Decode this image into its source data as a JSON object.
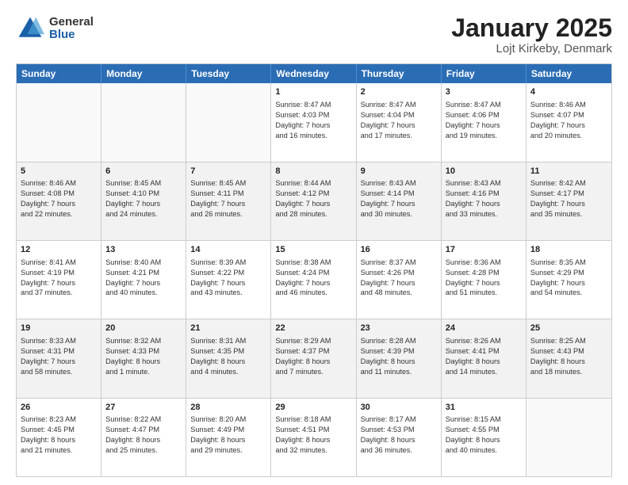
{
  "logo": {
    "general": "General",
    "blue": "Blue"
  },
  "title": "January 2025",
  "subtitle": "Lojt Kirkeby, Denmark",
  "days": [
    "Sunday",
    "Monday",
    "Tuesday",
    "Wednesday",
    "Thursday",
    "Friday",
    "Saturday"
  ],
  "weeks": [
    [
      {
        "day": "",
        "content": ""
      },
      {
        "day": "",
        "content": ""
      },
      {
        "day": "",
        "content": ""
      },
      {
        "day": "1",
        "content": "Sunrise: 8:47 AM\nSunset: 4:03 PM\nDaylight: 7 hours\nand 16 minutes."
      },
      {
        "day": "2",
        "content": "Sunrise: 8:47 AM\nSunset: 4:04 PM\nDaylight: 7 hours\nand 17 minutes."
      },
      {
        "day": "3",
        "content": "Sunrise: 8:47 AM\nSunset: 4:06 PM\nDaylight: 7 hours\nand 19 minutes."
      },
      {
        "day": "4",
        "content": "Sunrise: 8:46 AM\nSunset: 4:07 PM\nDaylight: 7 hours\nand 20 minutes."
      }
    ],
    [
      {
        "day": "5",
        "content": "Sunrise: 8:46 AM\nSunset: 4:08 PM\nDaylight: 7 hours\nand 22 minutes."
      },
      {
        "day": "6",
        "content": "Sunrise: 8:45 AM\nSunset: 4:10 PM\nDaylight: 7 hours\nand 24 minutes."
      },
      {
        "day": "7",
        "content": "Sunrise: 8:45 AM\nSunset: 4:11 PM\nDaylight: 7 hours\nand 26 minutes."
      },
      {
        "day": "8",
        "content": "Sunrise: 8:44 AM\nSunset: 4:12 PM\nDaylight: 7 hours\nand 28 minutes."
      },
      {
        "day": "9",
        "content": "Sunrise: 8:43 AM\nSunset: 4:14 PM\nDaylight: 7 hours\nand 30 minutes."
      },
      {
        "day": "10",
        "content": "Sunrise: 8:43 AM\nSunset: 4:16 PM\nDaylight: 7 hours\nand 33 minutes."
      },
      {
        "day": "11",
        "content": "Sunrise: 8:42 AM\nSunset: 4:17 PM\nDaylight: 7 hours\nand 35 minutes."
      }
    ],
    [
      {
        "day": "12",
        "content": "Sunrise: 8:41 AM\nSunset: 4:19 PM\nDaylight: 7 hours\nand 37 minutes."
      },
      {
        "day": "13",
        "content": "Sunrise: 8:40 AM\nSunset: 4:21 PM\nDaylight: 7 hours\nand 40 minutes."
      },
      {
        "day": "14",
        "content": "Sunrise: 8:39 AM\nSunset: 4:22 PM\nDaylight: 7 hours\nand 43 minutes."
      },
      {
        "day": "15",
        "content": "Sunrise: 8:38 AM\nSunset: 4:24 PM\nDaylight: 7 hours\nand 46 minutes."
      },
      {
        "day": "16",
        "content": "Sunrise: 8:37 AM\nSunset: 4:26 PM\nDaylight: 7 hours\nand 48 minutes."
      },
      {
        "day": "17",
        "content": "Sunrise: 8:36 AM\nSunset: 4:28 PM\nDaylight: 7 hours\nand 51 minutes."
      },
      {
        "day": "18",
        "content": "Sunrise: 8:35 AM\nSunset: 4:29 PM\nDaylight: 7 hours\nand 54 minutes."
      }
    ],
    [
      {
        "day": "19",
        "content": "Sunrise: 8:33 AM\nSunset: 4:31 PM\nDaylight: 7 hours\nand 58 minutes."
      },
      {
        "day": "20",
        "content": "Sunrise: 8:32 AM\nSunset: 4:33 PM\nDaylight: 8 hours\nand 1 minute."
      },
      {
        "day": "21",
        "content": "Sunrise: 8:31 AM\nSunset: 4:35 PM\nDaylight: 8 hours\nand 4 minutes."
      },
      {
        "day": "22",
        "content": "Sunrise: 8:29 AM\nSunset: 4:37 PM\nDaylight: 8 hours\nand 7 minutes."
      },
      {
        "day": "23",
        "content": "Sunrise: 8:28 AM\nSunset: 4:39 PM\nDaylight: 8 hours\nand 11 minutes."
      },
      {
        "day": "24",
        "content": "Sunrise: 8:26 AM\nSunset: 4:41 PM\nDaylight: 8 hours\nand 14 minutes."
      },
      {
        "day": "25",
        "content": "Sunrise: 8:25 AM\nSunset: 4:43 PM\nDaylight: 8 hours\nand 18 minutes."
      }
    ],
    [
      {
        "day": "26",
        "content": "Sunrise: 8:23 AM\nSunset: 4:45 PM\nDaylight: 8 hours\nand 21 minutes."
      },
      {
        "day": "27",
        "content": "Sunrise: 8:22 AM\nSunset: 4:47 PM\nDaylight: 8 hours\nand 25 minutes."
      },
      {
        "day": "28",
        "content": "Sunrise: 8:20 AM\nSunset: 4:49 PM\nDaylight: 8 hours\nand 29 minutes."
      },
      {
        "day": "29",
        "content": "Sunrise: 8:18 AM\nSunset: 4:51 PM\nDaylight: 8 hours\nand 32 minutes."
      },
      {
        "day": "30",
        "content": "Sunrise: 8:17 AM\nSunset: 4:53 PM\nDaylight: 8 hours\nand 36 minutes."
      },
      {
        "day": "31",
        "content": "Sunrise: 8:15 AM\nSunset: 4:55 PM\nDaylight: 8 hours\nand 40 minutes."
      },
      {
        "day": "",
        "content": ""
      }
    ]
  ]
}
